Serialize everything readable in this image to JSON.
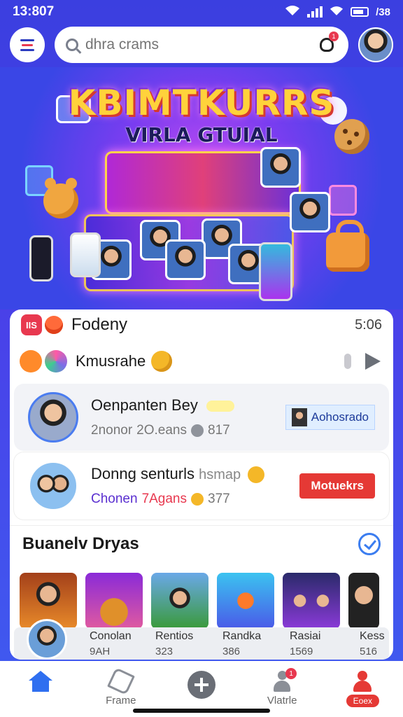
{
  "status_bar": {
    "time": "13:807",
    "battery": "/38"
  },
  "header": {
    "search_placeholder": "dhra crams",
    "bell_count": "1"
  },
  "banner": {
    "title": "KBIMTKURRS",
    "subtitle": "VIRLA GTUIAL"
  },
  "feed": {
    "badge": "IIS",
    "title": "Fodeny",
    "time": "5:06"
  },
  "kim": {
    "label": "Kmusrahe"
  },
  "users": [
    {
      "name": "Oenpanten Bey",
      "sub_a": "2nonor",
      "sub_b": "2O.eans",
      "count": "817",
      "tag": "Aohosrado"
    },
    {
      "name": "Donng senturls",
      "name_extra": "hsmap",
      "sub_a": "Chonen",
      "sub_b": "7Agans",
      "count": "377",
      "button": "Motuekrs"
    }
  ],
  "section": {
    "title": "Buanelv Dryas"
  },
  "stats": [
    {
      "label": "Conolan",
      "value": "9AH"
    },
    {
      "label": "Rentios",
      "value": "323"
    },
    {
      "label": "Randka",
      "value": "386"
    },
    {
      "label": "Rasiai",
      "value": "1569"
    },
    {
      "label": "Kess",
      "value": "516"
    }
  ],
  "nav": {
    "items": [
      {
        "label": ""
      },
      {
        "label": "Frame"
      },
      {
        "label": ""
      },
      {
        "label": "Vlatrle",
        "badge": "1"
      },
      {
        "label": "Eoex"
      }
    ]
  },
  "colors": {
    "accent_blue": "#2f6ff0",
    "accent_red": "#e53935",
    "background": "#3b3fe0"
  }
}
